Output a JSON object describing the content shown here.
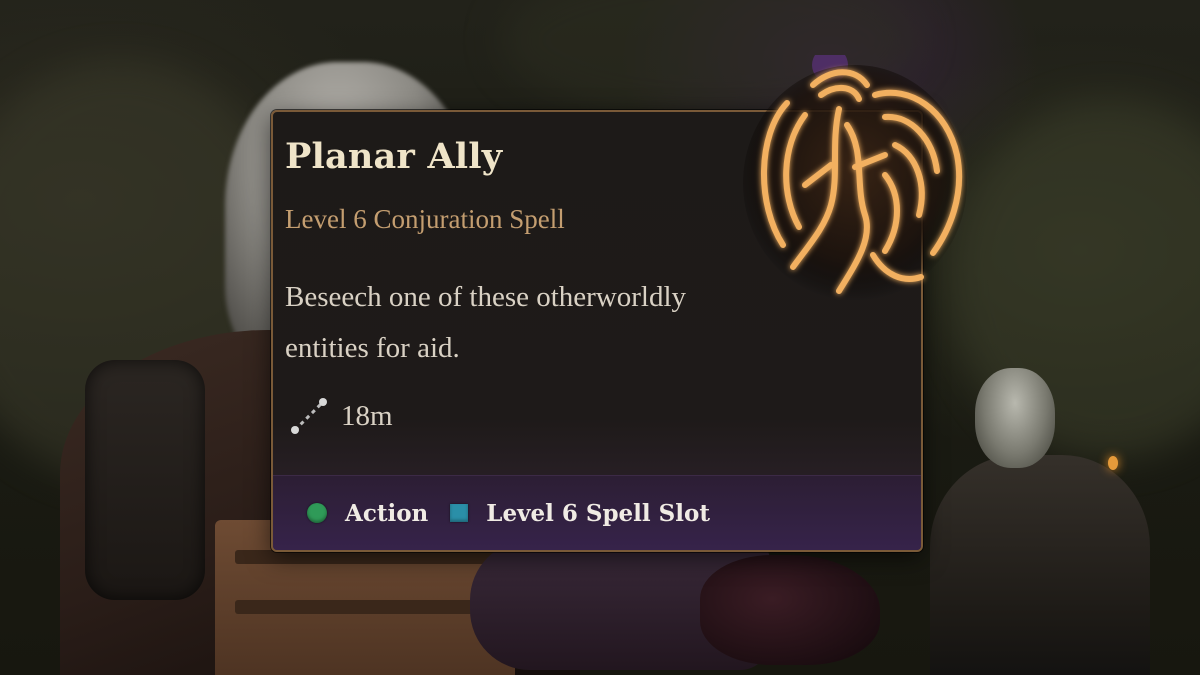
{
  "spell": {
    "name": "Planar Ally",
    "type": "Level 6 Conjuration Spell",
    "description": "Beseech one of these otherworldly entities for aid.",
    "range": "18m"
  },
  "costs": [
    {
      "label": "Action",
      "icon": "action-circle-icon",
      "color": "#2f9a58"
    },
    {
      "label": "Level 6 Spell Slot",
      "icon": "spell-slot-square-icon",
      "color": "#2a8fa8"
    }
  ],
  "colors": {
    "tooltip_border": "#7a5a38",
    "title": "#efe4c8",
    "subtitle": "#c49e70",
    "footer": "#36234a",
    "emblem_glow": "#f0a850"
  },
  "icons": {
    "range": "range-line-icon",
    "emblem": "planar-ally-emblem-icon"
  }
}
